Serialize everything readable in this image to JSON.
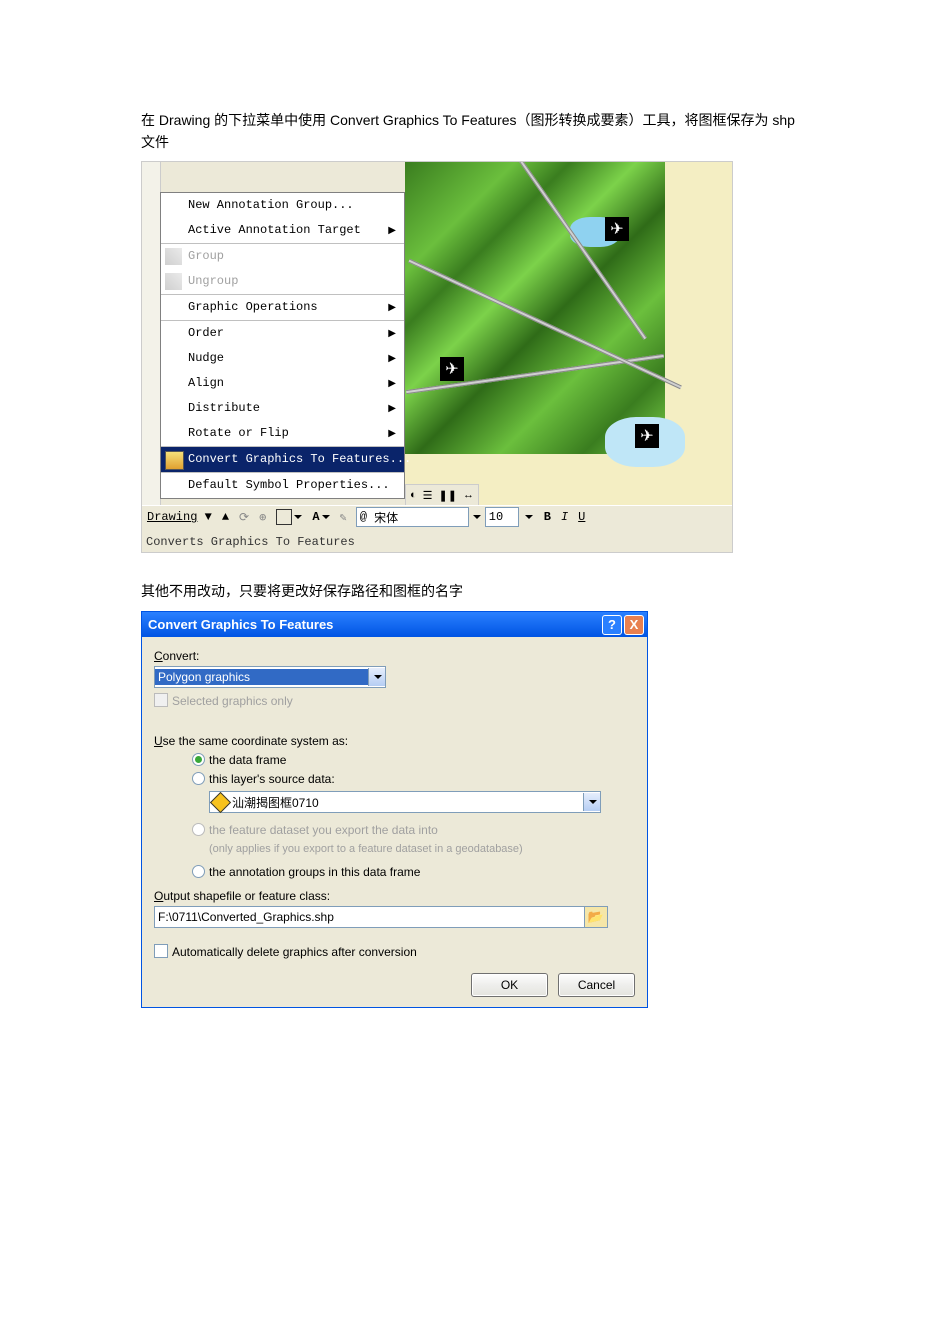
{
  "para1": "在 Drawing 的下拉菜单中使用 Convert Graphics To Features（图形转换成要素）工具，将图框保存为 shp 文件",
  "menu": {
    "items": [
      "New Annotation Group...",
      "Active Annotation Target",
      "Group",
      "Ungroup",
      "Graphic Operations",
      "Order",
      "Nudge",
      "Align",
      "Distribute",
      "Rotate or Flip",
      "Convert Graphics To Features...",
      "Default Symbol Properties..."
    ]
  },
  "toolbar": {
    "drawing_label": "Drawing",
    "a_label": "A",
    "font_marker": "@",
    "font_name": "宋体",
    "font_size": "10",
    "bold": "B",
    "italic": "I",
    "underline": "U"
  },
  "status": "Converts Graphics To Features",
  "maptools": {
    "globe": "◐",
    "hand": "☰",
    "pause": "❚❚",
    "arrow": "↔"
  },
  "para2": "其他不用改动，只要将更改好保存路径和图框的名字",
  "dialog": {
    "title": "Convert Graphics To Features",
    "convert_label": "Convert:",
    "convert_value": "Polygon graphics",
    "selected_only": "Selected graphics only",
    "coord_label": "Use the same coordinate system as:",
    "opt_dataframe": "the data frame",
    "opt_layer": "this layer's source data:",
    "layer_value": "汕潮揭图框0710",
    "opt_dataset_l1": "the feature dataset you export the data into",
    "opt_dataset_l2": "(only applies if you export to a feature dataset in a geodatabase)",
    "opt_anno": "the annotation groups in this data frame",
    "output_label": "Output shapefile or feature class:",
    "output_value": "F:\\0711\\Converted_Graphics.shp",
    "auto_delete": "Automatically delete graphics after conversion",
    "ok": "OK",
    "cancel": "Cancel",
    "help": "?",
    "close": "X"
  }
}
